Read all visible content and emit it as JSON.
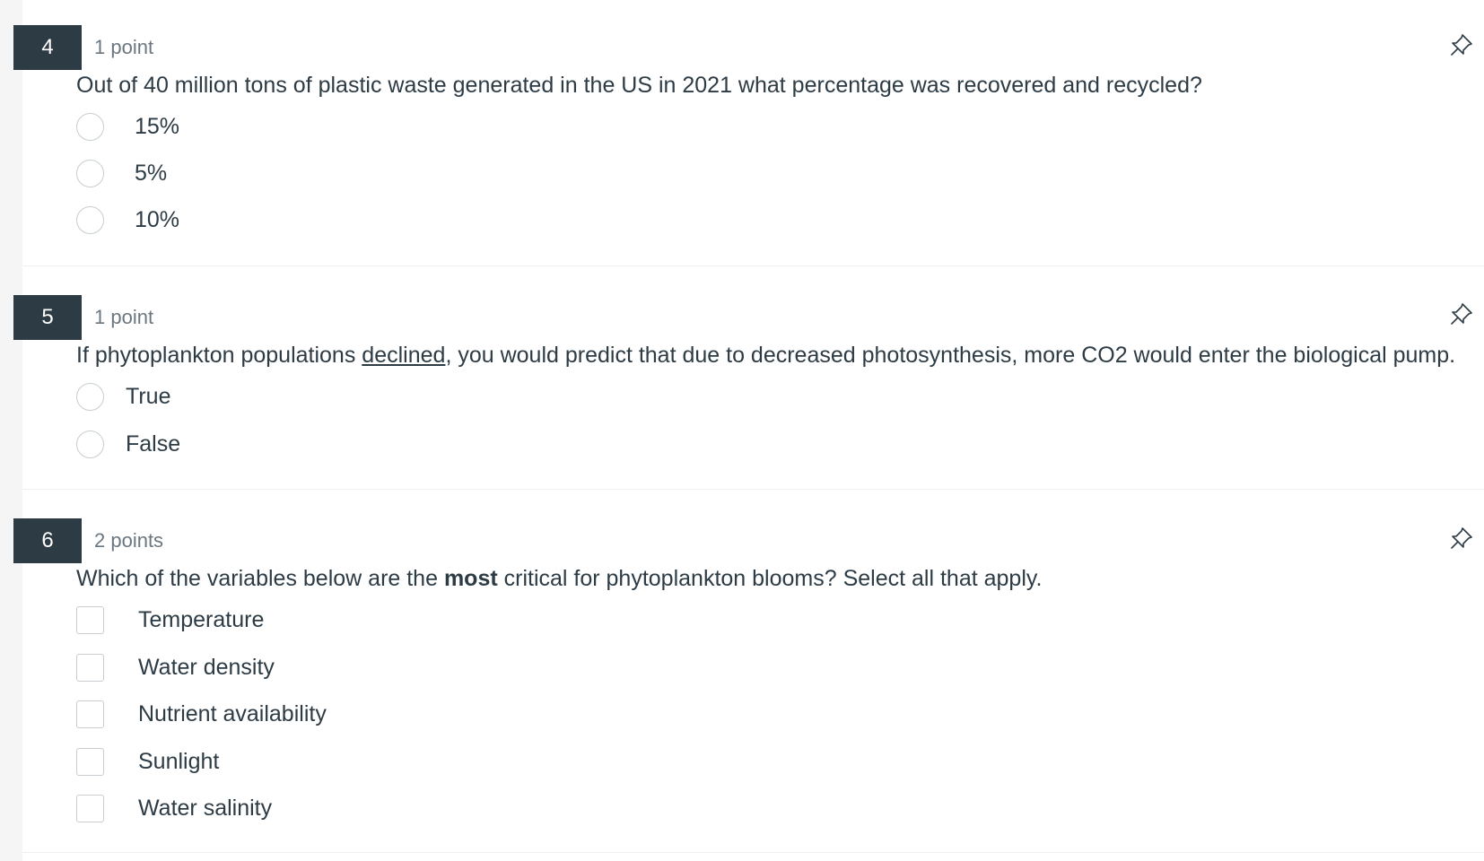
{
  "questions": [
    {
      "number": "4",
      "points": "1 point",
      "prompt": "Out of 40 million tons of plastic waste generated in the US in 2021 what percentage was recovered and recycled?",
      "input_type": "radio",
      "options": [
        "15%",
        "5%",
        "10%"
      ]
    },
    {
      "number": "5",
      "points": "1 point",
      "prompt_before": "If phytoplankton populations ",
      "prompt_underlined": "declined",
      "prompt_after": ", you would predict that due to decreased photosynthesis, more CO2 would enter the biological pump.",
      "input_type": "radio",
      "options": [
        "True",
        "False"
      ]
    },
    {
      "number": "6",
      "points": "2 points",
      "prompt_before": "Which of the variables below are the ",
      "prompt_bold": "most",
      "prompt_after": " critical for phytoplankton blooms? Select all that apply.",
      "input_type": "checkbox",
      "options": [
        "Temperature",
        "Water density",
        "Nutrient availability",
        "Sunlight",
        "Water salinity"
      ]
    }
  ],
  "icons": {
    "flag": "pushpin-icon"
  },
  "colors": {
    "number_badge": "#2d3b45",
    "text": "#2d3b45",
    "muted": "#6b7780",
    "control_border": "#c7cdd1"
  }
}
